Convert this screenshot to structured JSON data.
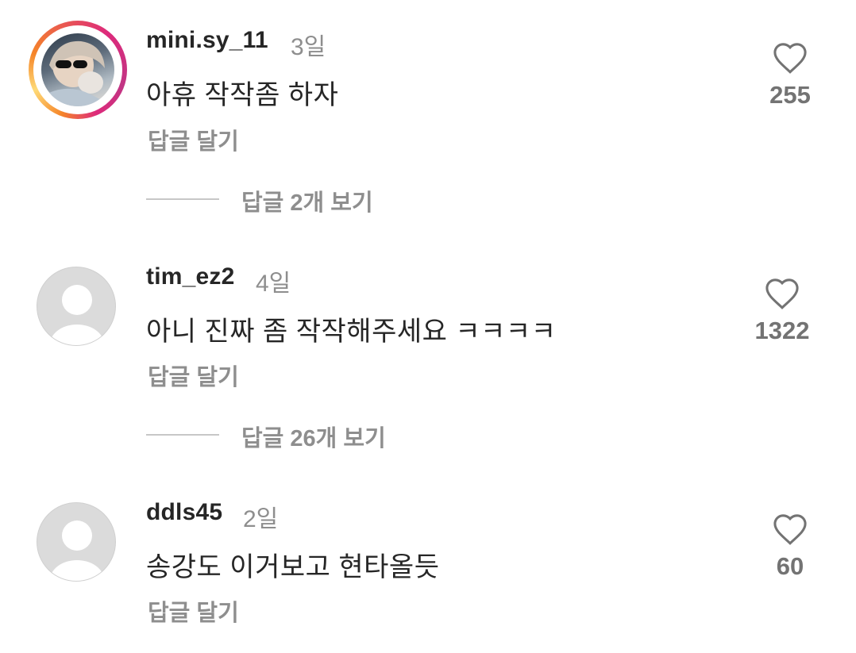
{
  "comments": [
    {
      "username": "mini.sy_11",
      "time": "3일",
      "text": "아휴 작작좀 하자",
      "reply_label": "답글 달기",
      "likes": "255",
      "view_replies": "답글 2개 보기",
      "avatar": "story-ring-photo"
    },
    {
      "username": "tim_ez2",
      "time": "4일",
      "text": "아니 진짜 좀 작작해주세요 ㅋㅋㅋㅋ",
      "reply_label": "답글 달기",
      "likes": "1322",
      "view_replies": "답글 26개 보기",
      "avatar": "default-user-icon"
    },
    {
      "username": "ddls45",
      "time": "2일",
      "text": "송강도 이거보고 현타올듯",
      "reply_label": "답글 달기",
      "likes": "60",
      "avatar": "default-user-icon"
    }
  ],
  "colors": {
    "primary_text": "#262626",
    "secondary_text": "#8e8e8e",
    "story_ring": [
      "#f58529",
      "#dd2a7b",
      "#c13584"
    ]
  },
  "icons": {
    "like": "heart-outline-icon"
  }
}
